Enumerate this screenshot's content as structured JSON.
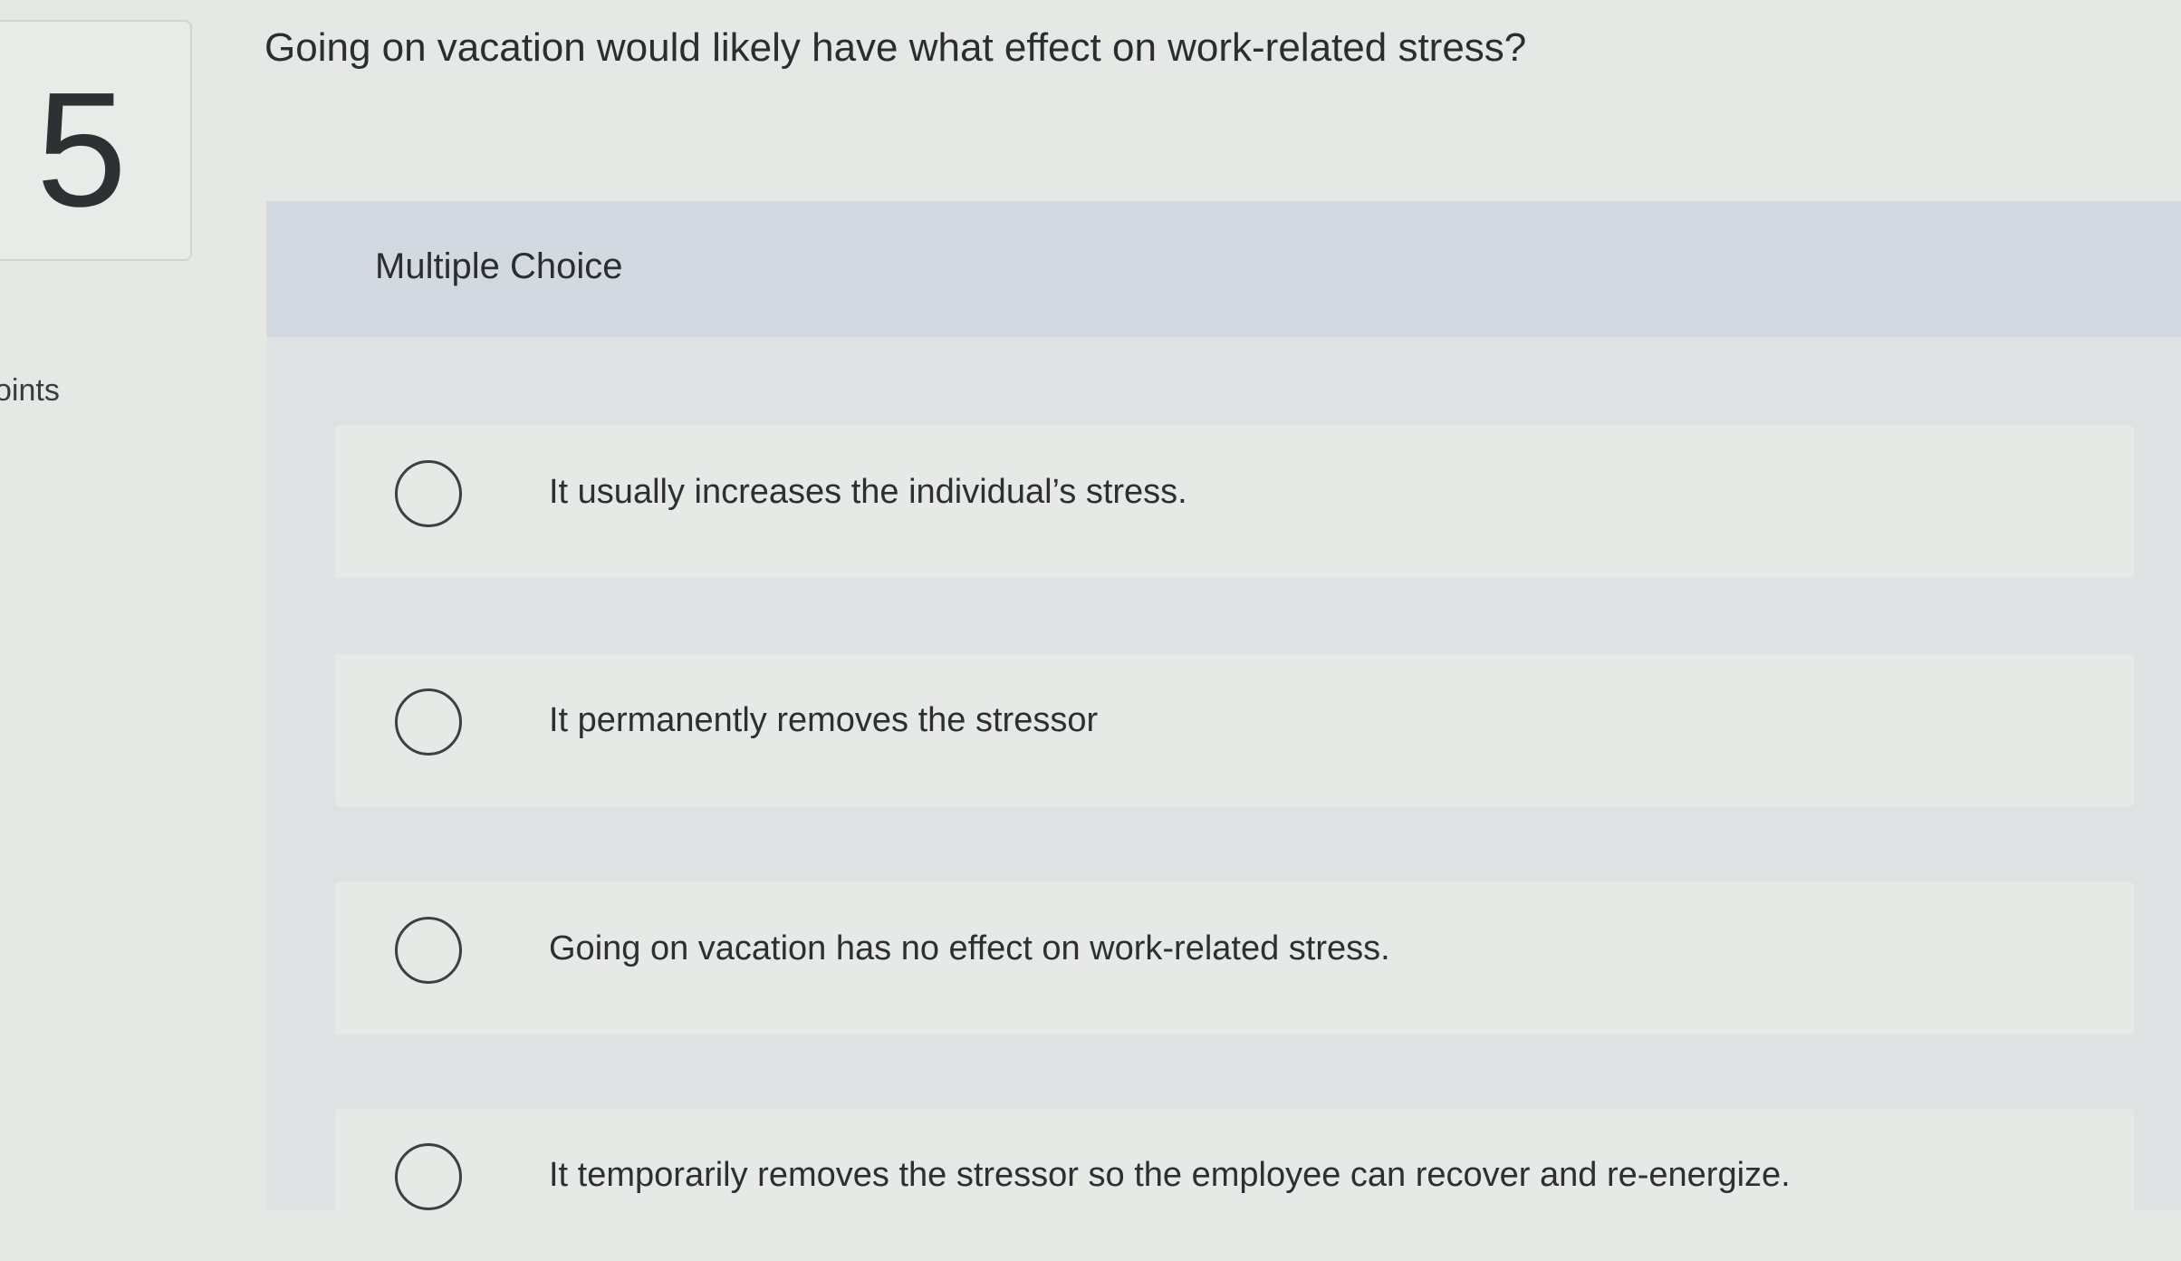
{
  "question": {
    "number": "5",
    "points_label": "oints",
    "text": "Going on vacation would likely have what effect on work-related stress?",
    "type_label": "Multiple Choice",
    "choices": [
      {
        "label": "It usually increases the individual’s stress."
      },
      {
        "label": "It permanently removes the stressor"
      },
      {
        "label": "Going on vacation has no effect on work-related stress."
      },
      {
        "label": "It temporarily removes the stressor so the employee can recover and re-energize."
      }
    ]
  }
}
